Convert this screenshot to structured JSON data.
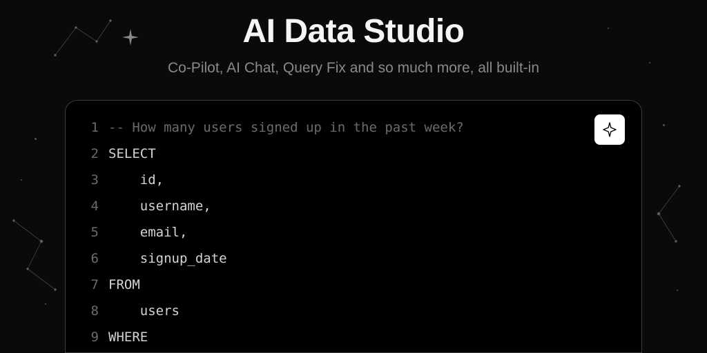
{
  "header": {
    "title": "AI Data Studio",
    "subtitle": "Co-Pilot, AI Chat, Query Fix and so much more, all built-in"
  },
  "editor": {
    "ai_button_icon": "sparkle-icon",
    "lines": [
      {
        "n": "1",
        "text": "-- How many users signed up in the past week?",
        "cls": "comment"
      },
      {
        "n": "2",
        "text": "SELECT",
        "cls": ""
      },
      {
        "n": "3",
        "text": "    id,",
        "cls": ""
      },
      {
        "n": "4",
        "text": "    username,",
        "cls": ""
      },
      {
        "n": "5",
        "text": "    email,",
        "cls": ""
      },
      {
        "n": "6",
        "text": "    signup_date",
        "cls": ""
      },
      {
        "n": "7",
        "text": "FROM",
        "cls": ""
      },
      {
        "n": "8",
        "text": "    users",
        "cls": ""
      },
      {
        "n": "9",
        "text": "WHERE",
        "cls": ""
      }
    ]
  }
}
